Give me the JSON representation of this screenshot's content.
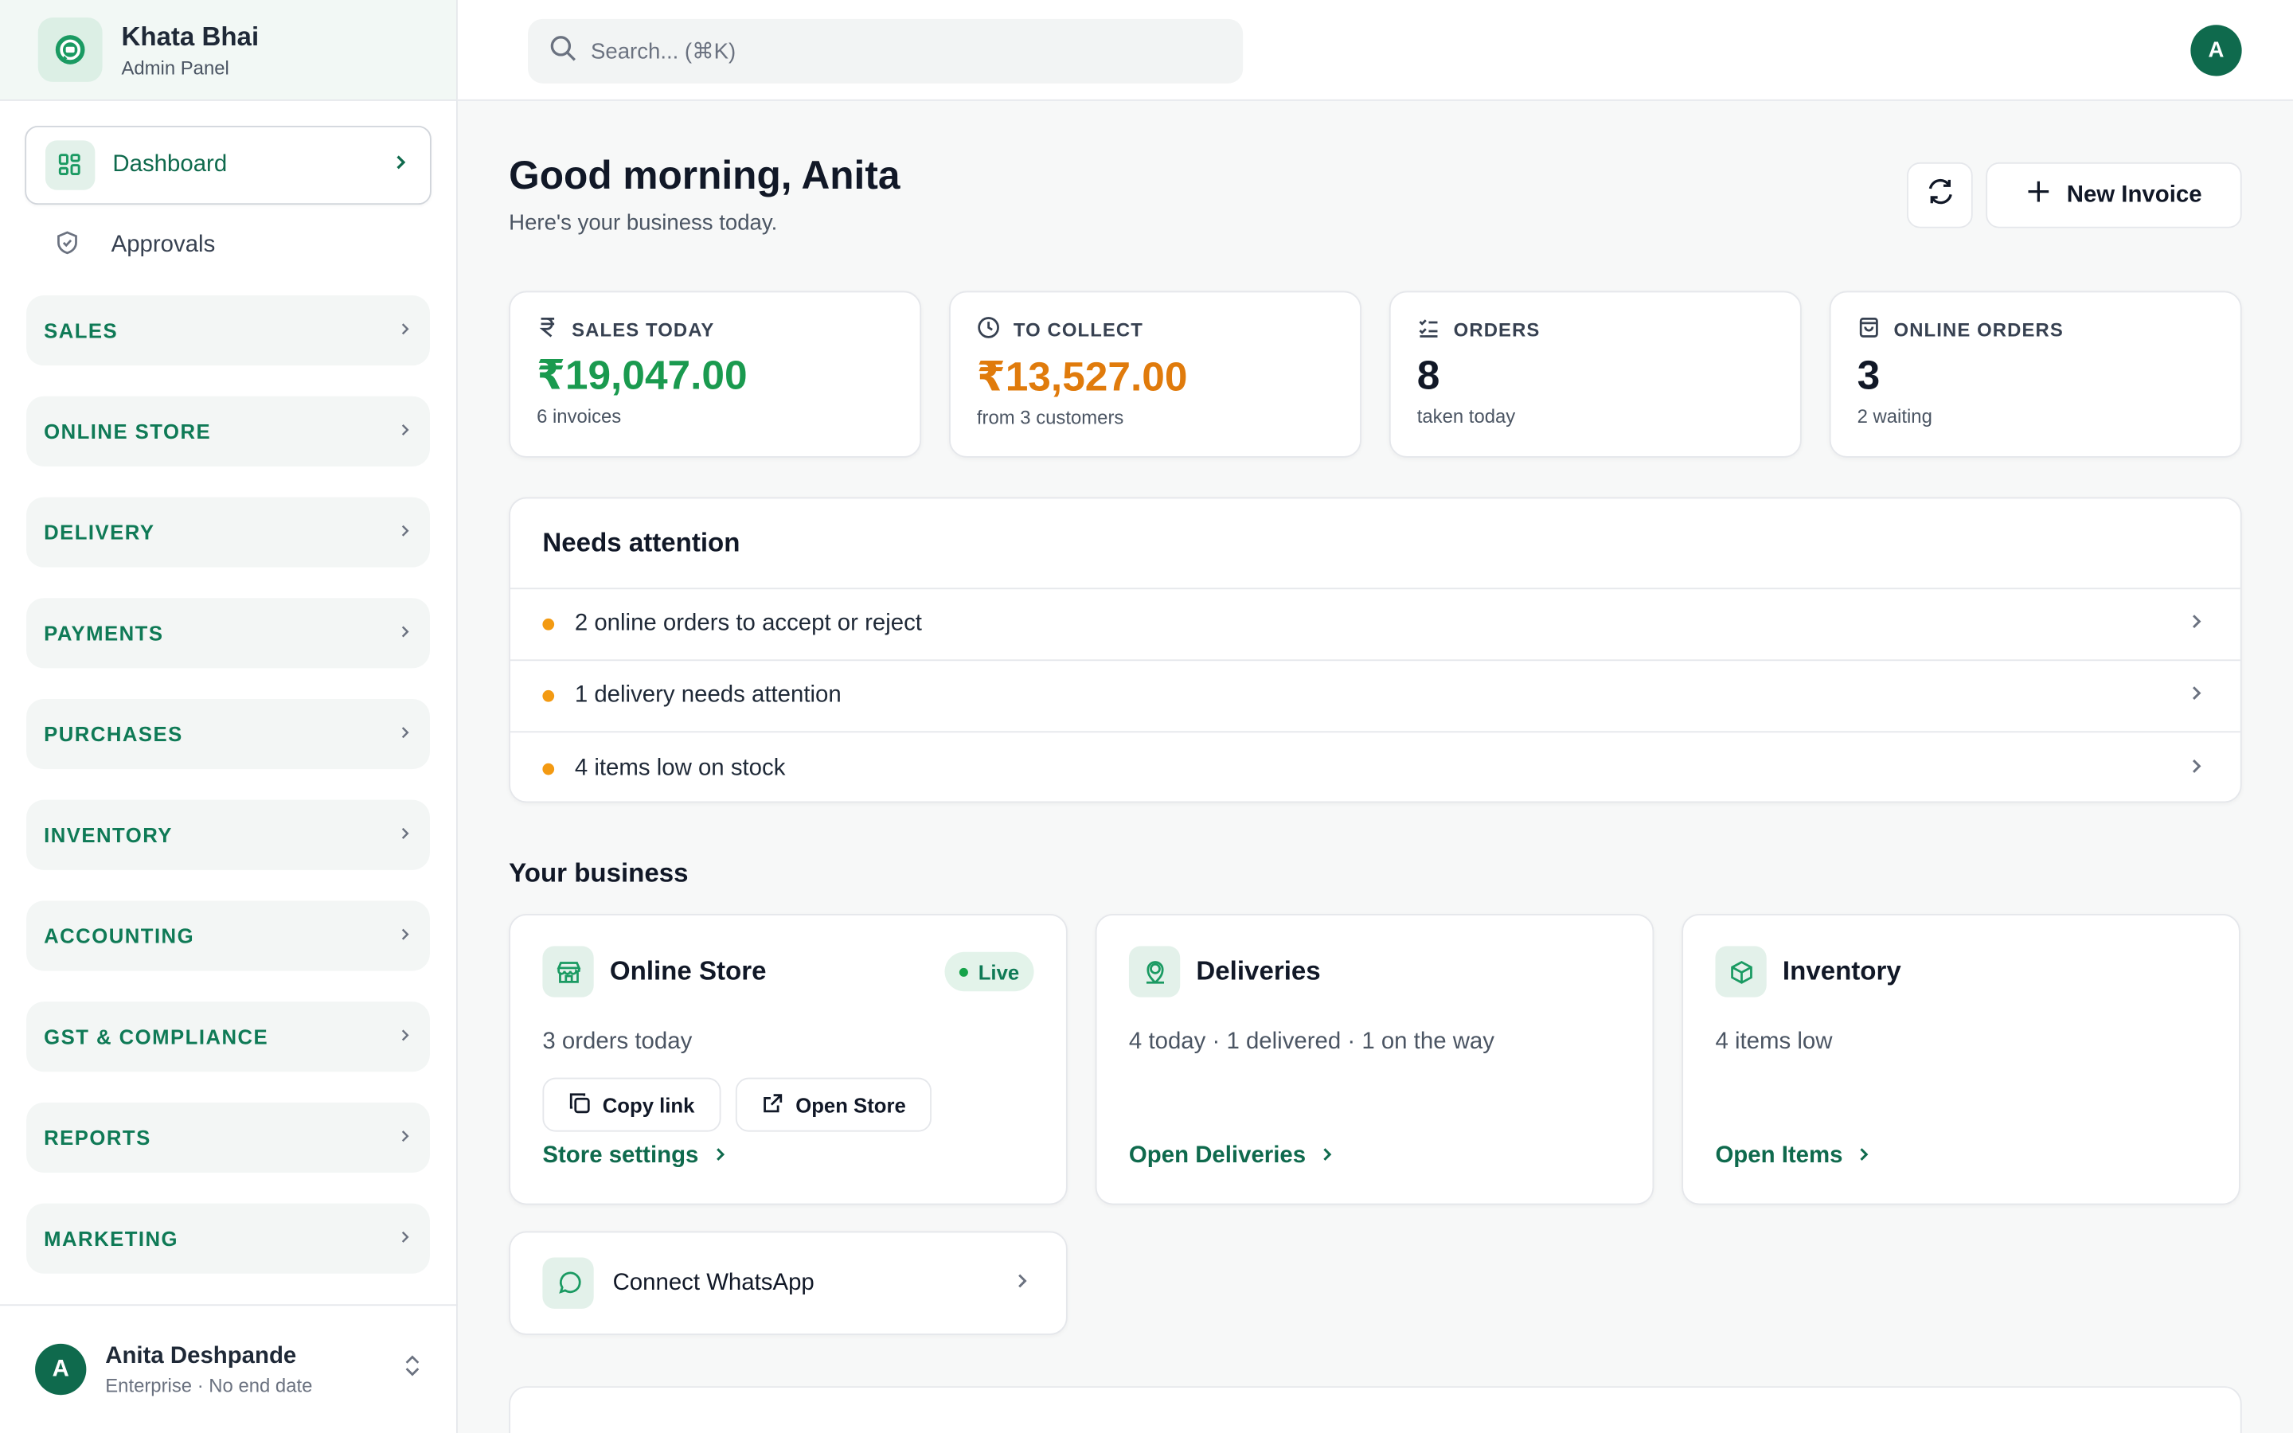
{
  "brand": {
    "title": "Khata Bhai",
    "subtitle": "Admin Panel"
  },
  "nav": {
    "dashboard": "Dashboard",
    "approvals": "Approvals",
    "sections": [
      "SALES",
      "ONLINE STORE",
      "DELIVERY",
      "PAYMENTS",
      "PURCHASES",
      "INVENTORY",
      "ACCOUNTING",
      "GST & COMPLIANCE",
      "REPORTS",
      "MARKETING"
    ]
  },
  "user": {
    "initial": "A",
    "name": "Anita Deshpande",
    "plan": "Enterprise · No end date"
  },
  "search": {
    "placeholder": "Search... (⌘K)"
  },
  "header": {
    "greeting": "Good morning, Anita",
    "subtitle": "Here's your business today.",
    "new_invoice": "New Invoice"
  },
  "stats": [
    {
      "label": "SALES TODAY",
      "value": "₹19,047.00",
      "note": "6 invoices",
      "color": "#1a9a4f",
      "icon": "rupee-icon"
    },
    {
      "label": "TO COLLECT",
      "value": "₹13,527.00",
      "note": "from 3 customers",
      "color": "#e07b0c",
      "icon": "clock-icon"
    },
    {
      "label": "ORDERS",
      "value": "8",
      "note": "taken today",
      "color": "#111827",
      "icon": "checklist-icon"
    },
    {
      "label": "ONLINE ORDERS",
      "value": "3",
      "note": "2 waiting",
      "color": "#111827",
      "icon": "shopping-bag-icon"
    }
  ],
  "attention": {
    "title": "Needs attention",
    "items": [
      "2 online orders to accept or reject",
      "1 delivery needs attention",
      "4 items low on stock"
    ]
  },
  "business": {
    "title": "Your business",
    "online_store": {
      "name": "Online Store",
      "badge": "Live",
      "meta": "3 orders today",
      "copy_link": "Copy link",
      "open_store": "Open Store",
      "link": "Store settings"
    },
    "deliveries": {
      "name": "Deliveries",
      "meta": "4 today · 1 delivered · 1 on the way",
      "link": "Open Deliveries"
    },
    "inventory": {
      "name": "Inventory",
      "meta": "4 items low",
      "link": "Open Items"
    }
  },
  "whatsapp": {
    "label": "Connect WhatsApp"
  },
  "colors": {
    "accent": "#0f6a4d",
    "warning": "#f39a12"
  }
}
